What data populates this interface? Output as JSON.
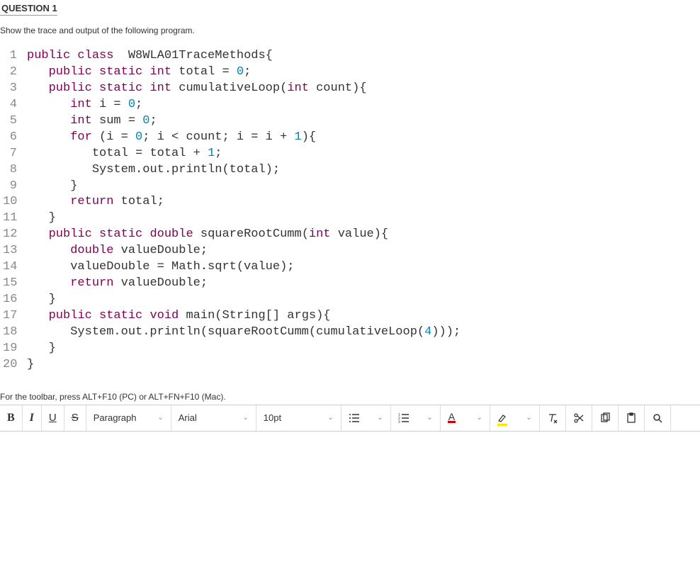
{
  "question": {
    "heading": "QUESTION 1",
    "instruction": "Show the trace and output of the following program."
  },
  "code": {
    "lines": [
      {
        "n": "1",
        "indent": 0,
        "tokens": [
          [
            "kw-type",
            "public"
          ],
          [
            "",
            " "
          ],
          [
            "kw-type",
            "class"
          ],
          [
            "",
            "  W8WLA01TraceMethods{"
          ]
        ]
      },
      {
        "n": "2",
        "indent": 1,
        "tokens": [
          [
            "kw-type",
            "public"
          ],
          [
            "",
            " "
          ],
          [
            "kw-type",
            "static"
          ],
          [
            "",
            " "
          ],
          [
            "kw-type",
            "int"
          ],
          [
            "",
            " total = "
          ],
          [
            "num-lit",
            "0"
          ],
          [
            "",
            ";"
          ]
        ]
      },
      {
        "n": "3",
        "indent": 1,
        "tokens": [
          [
            "kw-type",
            "public"
          ],
          [
            "",
            " "
          ],
          [
            "kw-type",
            "static"
          ],
          [
            "",
            " "
          ],
          [
            "kw-type",
            "int"
          ],
          [
            "",
            " cumulativeLoop("
          ],
          [
            "kw-type",
            "int"
          ],
          [
            "",
            " count){"
          ]
        ]
      },
      {
        "n": "4",
        "indent": 2,
        "tokens": [
          [
            "kw-type",
            "int"
          ],
          [
            "",
            " i = "
          ],
          [
            "num-lit",
            "0"
          ],
          [
            "",
            ";"
          ]
        ]
      },
      {
        "n": "5",
        "indent": 2,
        "tokens": [
          [
            "kw-type",
            "int"
          ],
          [
            "",
            " sum = "
          ],
          [
            "num-lit",
            "0"
          ],
          [
            "",
            ";"
          ]
        ]
      },
      {
        "n": "6",
        "indent": 2,
        "tokens": [
          [
            "kw-ctrl",
            "for"
          ],
          [
            "",
            " (i = "
          ],
          [
            "num-lit",
            "0"
          ],
          [
            "",
            "; i < count; i = i + "
          ],
          [
            "num-lit",
            "1"
          ],
          [
            "",
            ")"
          ],
          [
            "",
            "{"
          ]
        ]
      },
      {
        "n": "7",
        "indent": 3,
        "tokens": [
          [
            "",
            "total = total + "
          ],
          [
            "num-lit",
            "1"
          ],
          [
            "",
            ";"
          ]
        ]
      },
      {
        "n": "8",
        "indent": 3,
        "tokens": [
          [
            "",
            "System.out.println(total);"
          ]
        ]
      },
      {
        "n": "9",
        "indent": 2,
        "tokens": [
          [
            "",
            "}"
          ]
        ]
      },
      {
        "n": "10",
        "indent": 2,
        "tokens": [
          [
            "kw-ctrl",
            "return"
          ],
          [
            "",
            " total;"
          ]
        ]
      },
      {
        "n": "11",
        "indent": 1,
        "tokens": [
          [
            "",
            "}"
          ]
        ]
      },
      {
        "n": "12",
        "indent": 1,
        "tokens": [
          [
            "kw-type",
            "public"
          ],
          [
            "",
            " "
          ],
          [
            "kw-type",
            "static"
          ],
          [
            "",
            " "
          ],
          [
            "kw-type",
            "double"
          ],
          [
            "",
            " squareRootCumm("
          ],
          [
            "kw-type",
            "int"
          ],
          [
            "",
            " value){"
          ]
        ]
      },
      {
        "n": "13",
        "indent": 2,
        "tokens": [
          [
            "kw-type",
            "double"
          ],
          [
            "",
            " valueDouble;"
          ]
        ]
      },
      {
        "n": "14",
        "indent": 2,
        "tokens": [
          [
            "",
            "valueDouble = Math.sqrt(value);"
          ]
        ]
      },
      {
        "n": "15",
        "indent": 2,
        "tokens": [
          [
            "kw-ctrl",
            "return"
          ],
          [
            "",
            " valueDouble;"
          ]
        ]
      },
      {
        "n": "16",
        "indent": 1,
        "tokens": [
          [
            "",
            "}"
          ]
        ]
      },
      {
        "n": "17",
        "indent": 1,
        "tokens": [
          [
            "kw-type",
            "public"
          ],
          [
            "",
            " "
          ],
          [
            "kw-type",
            "static"
          ],
          [
            "",
            " "
          ],
          [
            "kw-type",
            "void"
          ],
          [
            "",
            " main(String[] args){"
          ]
        ]
      },
      {
        "n": "18",
        "indent": 2,
        "tokens": [
          [
            "",
            "System.out.println(squareRootCumm(cumulativeLoop("
          ],
          [
            "num-lit",
            "4"
          ],
          [
            "",
            ")));"
          ]
        ]
      },
      {
        "n": "19",
        "indent": 1,
        "tokens": [
          [
            "",
            "}"
          ]
        ]
      },
      {
        "n": "20",
        "indent": 0,
        "tokens": [
          [
            "",
            "}"
          ]
        ]
      }
    ]
  },
  "toolbar": {
    "hint": "For the toolbar, press ALT+F10 (PC) or ALT+FN+F10 (Mac).",
    "bold": "B",
    "italic": "I",
    "underline": "U",
    "strike": "S",
    "style_select": "Paragraph",
    "font_select": "Arial",
    "size_select": "10pt",
    "textcolor_glyph": "A"
  }
}
